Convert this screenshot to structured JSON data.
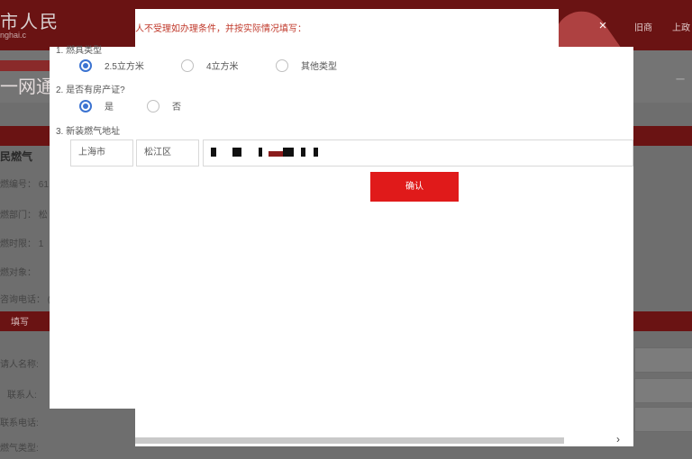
{
  "background": {
    "logo_cn": "市人民",
    "logo_en": "nghai.c",
    "header_links": [
      "旧商",
      "上政"
    ],
    "subnav_tag": "",
    "service_title": "一网通",
    "crumb": "一",
    "bar1_text": "",
    "section_title": "民燃气",
    "info_rows": [
      "燃编号：  61",
      "燃部门：  松",
      "燃时限：  1",
      "燃对象：",
      "咨询电话：  (0"
    ],
    "bar2_text": "填写",
    "form_labels": [
      "请人名称:",
      "联系人:",
      "联系电话:",
      "燃气类型:"
    ]
  },
  "dialog": {
    "notice": "人不受理如办理条件，并按实际情况填写：",
    "q1_label": "1. 燃具类型",
    "q1_options": [
      "2.5立方米",
      "4立方米",
      "其他类型"
    ],
    "q1_selected": "2.5立方米",
    "q2_label": "2. 是否有房产证?",
    "q2_options": [
      "是",
      "否"
    ],
    "q2_selected": "是",
    "q3_label": "3. 新装燃气地址",
    "city_value": "上海市",
    "district_value": "松江区",
    "confirm_label": "确认",
    "close_glyph": "×",
    "scroll_glyph": "›"
  },
  "colors": {
    "accent_red": "#e01a1a",
    "notice_red": "#c0392b",
    "radio_blue": "#3b73d1",
    "header_dark": "#6a1313"
  }
}
